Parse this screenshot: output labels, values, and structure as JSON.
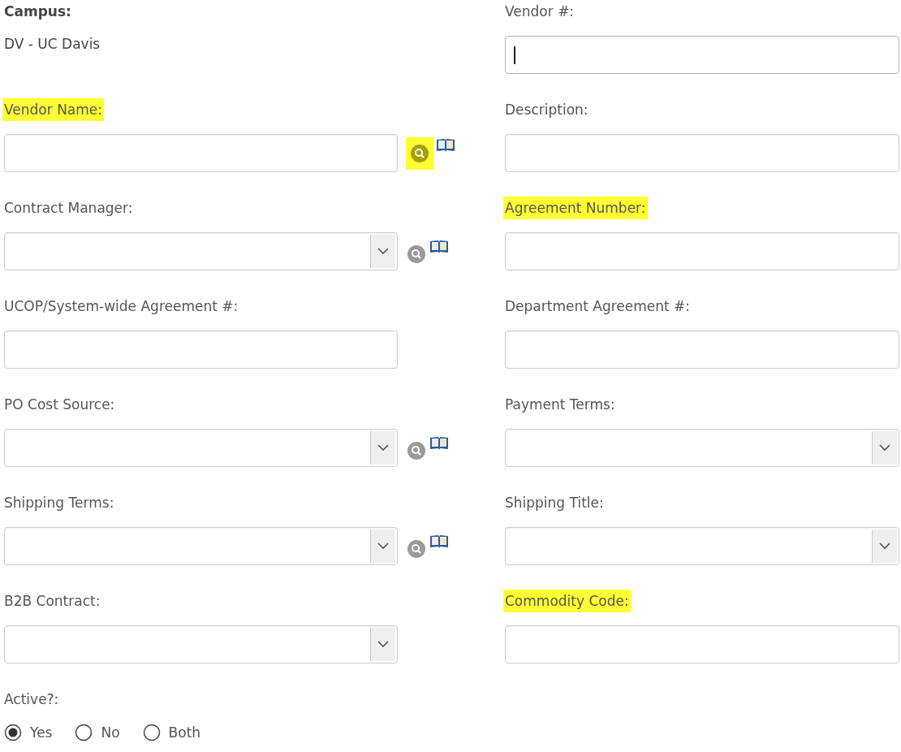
{
  "left_fields": [
    {
      "kind": "static",
      "label": "Campus:",
      "value": "DV - UC Davis",
      "highlighted": false
    },
    {
      "kind": "text",
      "label": "Vendor Name:",
      "highlighted": true,
      "lookup": true,
      "lookup_highlighted": true
    },
    {
      "kind": "select",
      "label": "Contract Manager:",
      "highlighted": false,
      "lookup": true,
      "lookup_highlighted": false
    },
    {
      "kind": "text",
      "label": "UCOP/System-wide Agreement #:",
      "highlighted": false,
      "lookup": false
    },
    {
      "kind": "select",
      "label": "PO Cost Source:",
      "highlighted": false,
      "lookup": true,
      "lookup_highlighted": false
    },
    {
      "kind": "select",
      "label": "Shipping Terms:",
      "highlighted": false,
      "lookup": true,
      "lookup_highlighted": false
    },
    {
      "kind": "select",
      "label": "B2B Contract:",
      "highlighted": false,
      "lookup": false
    }
  ],
  "right_fields": [
    {
      "kind": "text",
      "label": "Vendor #:",
      "highlighted": false,
      "focused": true
    },
    {
      "kind": "text",
      "label": "Description:",
      "highlighted": false,
      "focused": false
    },
    {
      "kind": "text",
      "label": "Agreement Number:",
      "highlighted": true,
      "focused": false
    },
    {
      "kind": "text",
      "label": "Department Agreement #:",
      "highlighted": false,
      "focused": false
    },
    {
      "kind": "select",
      "label": "Payment Terms:",
      "highlighted": false
    },
    {
      "kind": "select",
      "label": "Shipping Title:",
      "highlighted": false
    },
    {
      "kind": "text",
      "label": "Commodity Code:",
      "highlighted": true,
      "focused": false
    }
  ],
  "active": {
    "label": "Active?:",
    "options": [
      {
        "label": "Yes",
        "selected": true
      },
      {
        "label": "No",
        "selected": false
      },
      {
        "label": "Both",
        "selected": false
      }
    ]
  }
}
